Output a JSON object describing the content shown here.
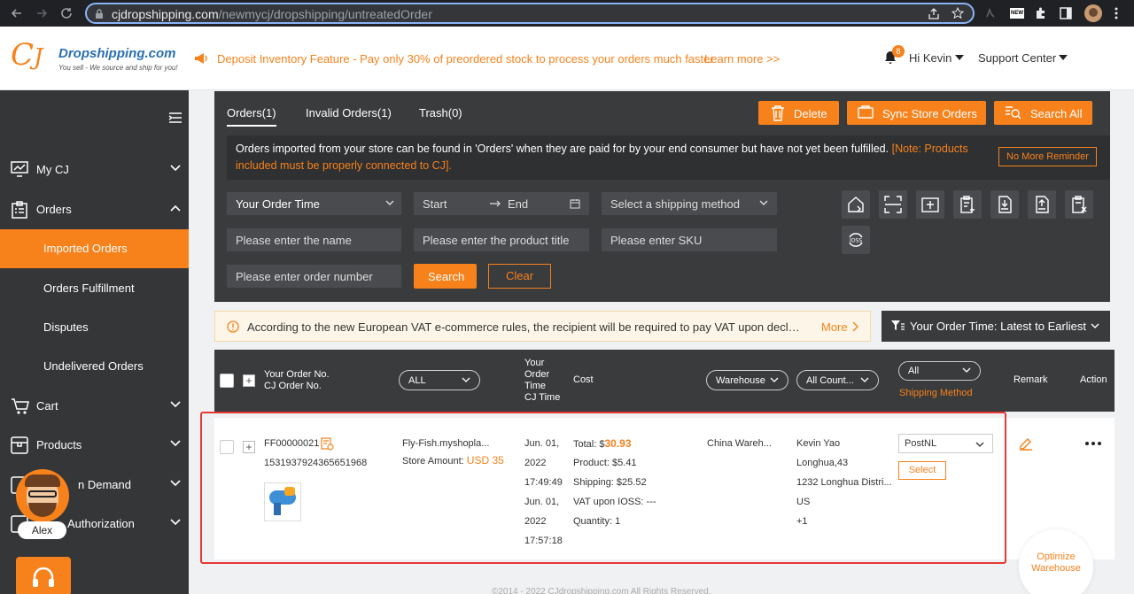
{
  "browser": {
    "url_domain": "cjdropshipping.com",
    "url_path": "/newmycj/dropshipping/untreatedOrder"
  },
  "header": {
    "logo_name": "Dropshipping.com",
    "logo_tagline": "You sell - We source and ship for you!",
    "notice": "Deposit Inventory Feature - Pay only 30% of preordered stock to process your orders much faster",
    "learn_more": "Learn more >>",
    "notification_count": "8",
    "user_greeting": "Hi Kevin",
    "support": "Support Center"
  },
  "sidebar": {
    "items": [
      {
        "label": "My CJ"
      },
      {
        "label": "Orders"
      },
      {
        "label": "Imported Orders"
      },
      {
        "label": "Orders Fulfillment"
      },
      {
        "label": "Disputes"
      },
      {
        "label": "Undelivered Orders"
      },
      {
        "label": "Cart"
      },
      {
        "label": "Products"
      },
      {
        "label": "n Demand"
      },
      {
        "label": "Authorization"
      }
    ],
    "avatar_name": "Alex"
  },
  "toolbar": {
    "tabs": [
      "Orders(1)",
      "Invalid Orders(1)",
      "Trash(0)"
    ],
    "delete": "Delete",
    "sync": "Sync Store Orders",
    "search_all": "Search All",
    "info_text": "Orders imported from your store can be found in 'Orders' when they are paid for by your end consumer but have not yet been fulfilled.",
    "info_note": "[Note: Products included must be properly connected to CJ].",
    "no_more_reminder": "No More Reminder",
    "order_time": "Your Order Time",
    "start": "Start",
    "end": "End",
    "shipping_method": "Select a shipping method",
    "name_placeholder": "Please enter the name",
    "product_title_placeholder": "Please enter the product title",
    "sku_placeholder": "Please enter SKU",
    "order_number_placeholder": "Please enter order number",
    "search": "Search",
    "clear": "Clear"
  },
  "vat": {
    "text": "According to the new European VAT e-commerce rules, the recipient will be required to pay VAT upon declaration of goods",
    "more": "More",
    "sort": "Your Order Time: Latest to Earliest"
  },
  "table_header": {
    "order_no_1": "Your Order No.",
    "order_no_2": "CJ Order No.",
    "store_filter": "ALL",
    "time_1": "Your",
    "time_2": "Order",
    "time_3": "Time",
    "time_4": "CJ Time",
    "cost": "Cost",
    "warehouse": "Warehouse",
    "country": "All Count...",
    "shipping_filter": "All",
    "shipping_method": "Shipping Method",
    "remark": "Remark",
    "action": "Action"
  },
  "row": {
    "order_no": "FF00000021",
    "cj_order_no": "1531937924365651968",
    "store": "Fly-Fish.myshopla...",
    "store_amount_label": "Store Amount:",
    "store_amount": "USD 35",
    "date1": "Jun. 01,",
    "year1": "2022",
    "time1": "17:49:49",
    "date2": "Jun. 01,",
    "year2": "2022",
    "time2": "17:57:18",
    "total_label": "Total: $",
    "total": "30.93",
    "product": "Product: $5.41",
    "shipping": "Shipping: $25.52",
    "vat": "VAT upon IOSS: ---",
    "quantity": "Quantity: 1",
    "warehouse": "China Wareh...",
    "name": "Kevin Yao",
    "addr1": "Longhua,43",
    "addr2": "1232 Longhua Distri...",
    "country": "US",
    "phone": "+1",
    "shipping_method": "PostNL",
    "select": "Select"
  },
  "optimize": {
    "line1": "Optimize",
    "line2": "Warehouse"
  },
  "footer": {
    "text": "©2014 - 2022 CJdropshipping.com All Rights Reserved."
  }
}
